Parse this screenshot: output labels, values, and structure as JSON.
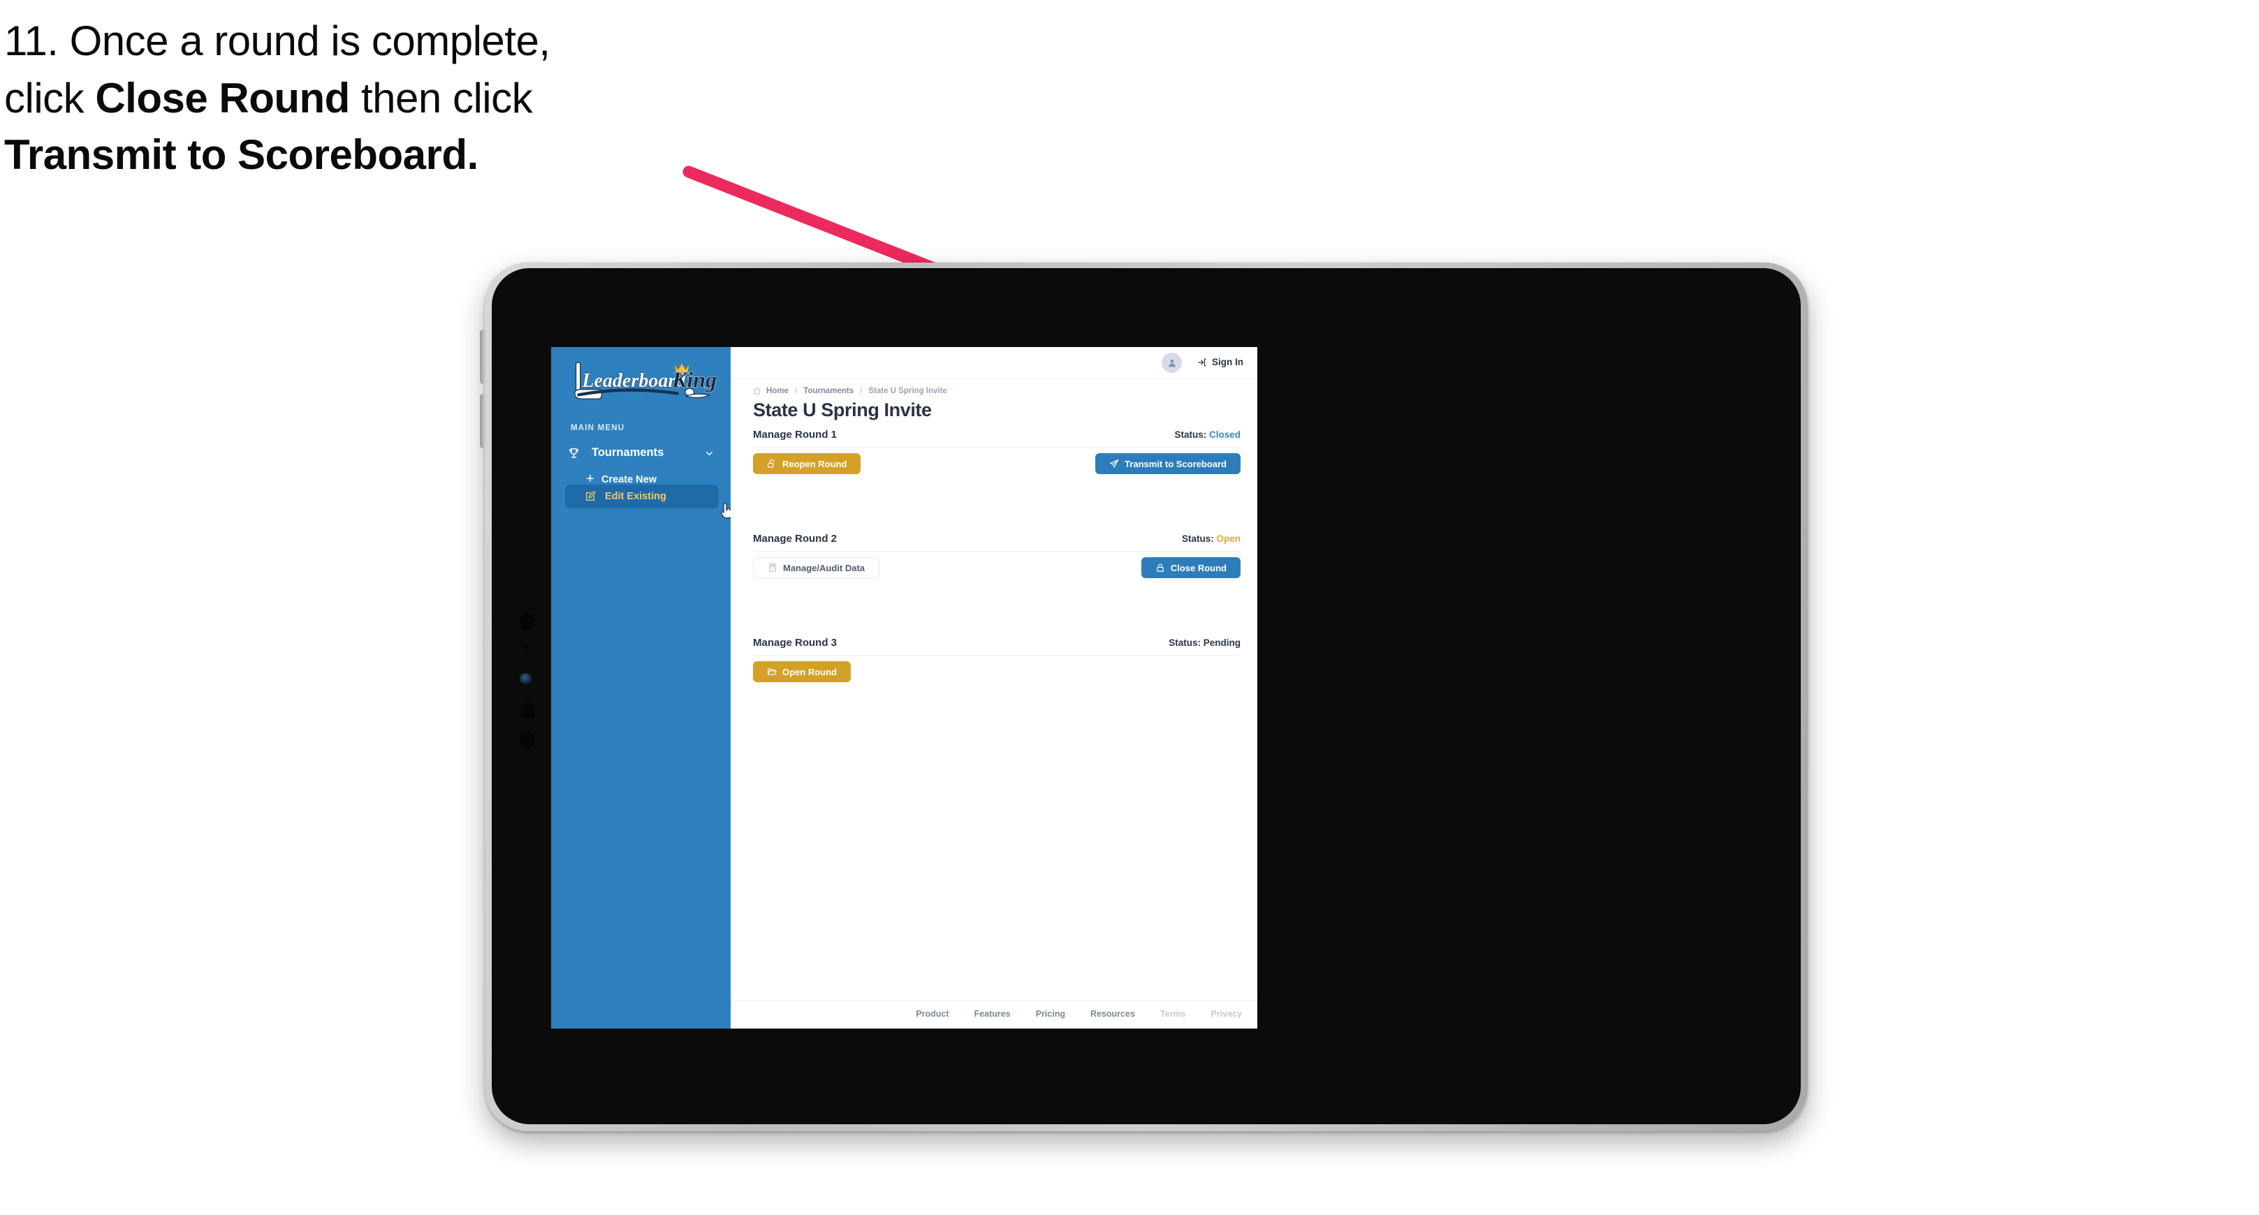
{
  "caption": {
    "line1_prefix": "11. Once a round is complete,",
    "line2_prefix": "click ",
    "line2_bold": "Close Round",
    "line2_suffix": " then click",
    "line3_bold": "Transmit to Scoreboard."
  },
  "annotation": {
    "arrow_color": "#ec2a5d",
    "points_to": "Transmit to Scoreboard"
  },
  "app": {
    "brand": {
      "logo_word_1": "Leaderboard",
      "logo_word_2": "King",
      "sidebar_color": "#2f80be"
    },
    "sidebar": {
      "section_label": "MAIN MENU",
      "items": [
        {
          "label": "Tournaments",
          "icon": "trophy-icon",
          "expanded": true,
          "chevron": "chevron-down-icon"
        },
        {
          "label": "Create New",
          "icon": "plus-icon"
        },
        {
          "label": "Edit Existing",
          "icon": "edit-square-icon",
          "active": true,
          "active_text_color": "#f3c76a",
          "active_bg": "#1f6ba8"
        }
      ]
    },
    "topbar": {
      "avatar_icon": "user-avatar-icon",
      "signin_label": "Sign In",
      "signin_icon": "login-arrow-icon"
    },
    "breadcrumb": {
      "home_icon": "home-icon",
      "items": [
        "Home",
        "Tournaments",
        "State U Spring Invite"
      ],
      "separator": "/"
    },
    "page_title": "State U Spring Invite",
    "rounds": [
      {
        "title": "Manage Round 1",
        "status_label": "Status:",
        "status_value": "Closed",
        "status_color": "#3a85c8",
        "left_button": {
          "label": "Reopen Round",
          "icon": "unlock-icon",
          "style": "gold"
        },
        "right_button": {
          "label": "Transmit to Scoreboard",
          "icon": "send-plane-icon",
          "style": "blue"
        }
      },
      {
        "title": "Manage Round 2",
        "status_label": "Status:",
        "status_value": "Open",
        "status_color": "#e0a93c",
        "left_button": {
          "label": "Manage/Audit Data",
          "icon": "calculator-icon",
          "style": "ghost"
        },
        "right_button": {
          "label": "Close Round",
          "icon": "lock-icon",
          "style": "blue"
        }
      },
      {
        "title": "Manage Round 3",
        "status_label": "Status:",
        "status_value": "Pending",
        "status_color": "#2b3445",
        "left_button": {
          "label": "Open Round",
          "icon": "folder-open-icon",
          "style": "gold"
        },
        "right_button": null
      }
    ],
    "footer": {
      "links": [
        {
          "label": "Product",
          "dim": false
        },
        {
          "label": "Features",
          "dim": false
        },
        {
          "label": "Pricing",
          "dim": false
        },
        {
          "label": "Resources",
          "dim": false
        },
        {
          "label": "Terms",
          "dim": true
        },
        {
          "label": "Privacy",
          "dim": true
        }
      ]
    }
  }
}
